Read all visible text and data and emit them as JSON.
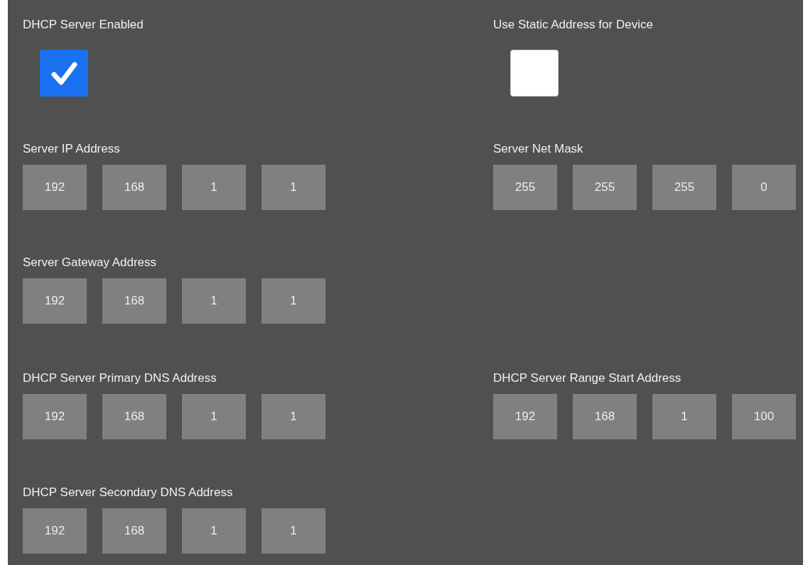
{
  "rows": [
    {
      "left": {
        "kind": "checkbox",
        "label": "DHCP Server Enabled",
        "checked": true
      },
      "right": {
        "kind": "checkbox",
        "label": "Use Static Address for Device",
        "checked": false
      }
    },
    {
      "left": {
        "kind": "address",
        "label": "Server IP Address",
        "octets": [
          "192",
          "168",
          "1",
          "1"
        ]
      },
      "right": {
        "kind": "address",
        "label": "Server Net Mask",
        "octets": [
          "255",
          "255",
          "255",
          "0"
        ]
      }
    },
    {
      "left": {
        "kind": "address",
        "label": "Server Gateway Address",
        "octets": [
          "192",
          "168",
          "1",
          "1"
        ]
      }
    },
    {
      "left": {
        "kind": "address",
        "label": "DHCP Server Primary DNS Address",
        "octets": [
          "192",
          "168",
          "1",
          "1"
        ]
      },
      "right": {
        "kind": "address",
        "label": "DHCP Server Range Start Address",
        "octets": [
          "192",
          "168",
          "1",
          "100"
        ]
      }
    },
    {
      "left": {
        "kind": "address",
        "label": "DHCP Server Secondary DNS Address",
        "octets": [
          "192",
          "168",
          "1",
          "1"
        ]
      }
    }
  ]
}
